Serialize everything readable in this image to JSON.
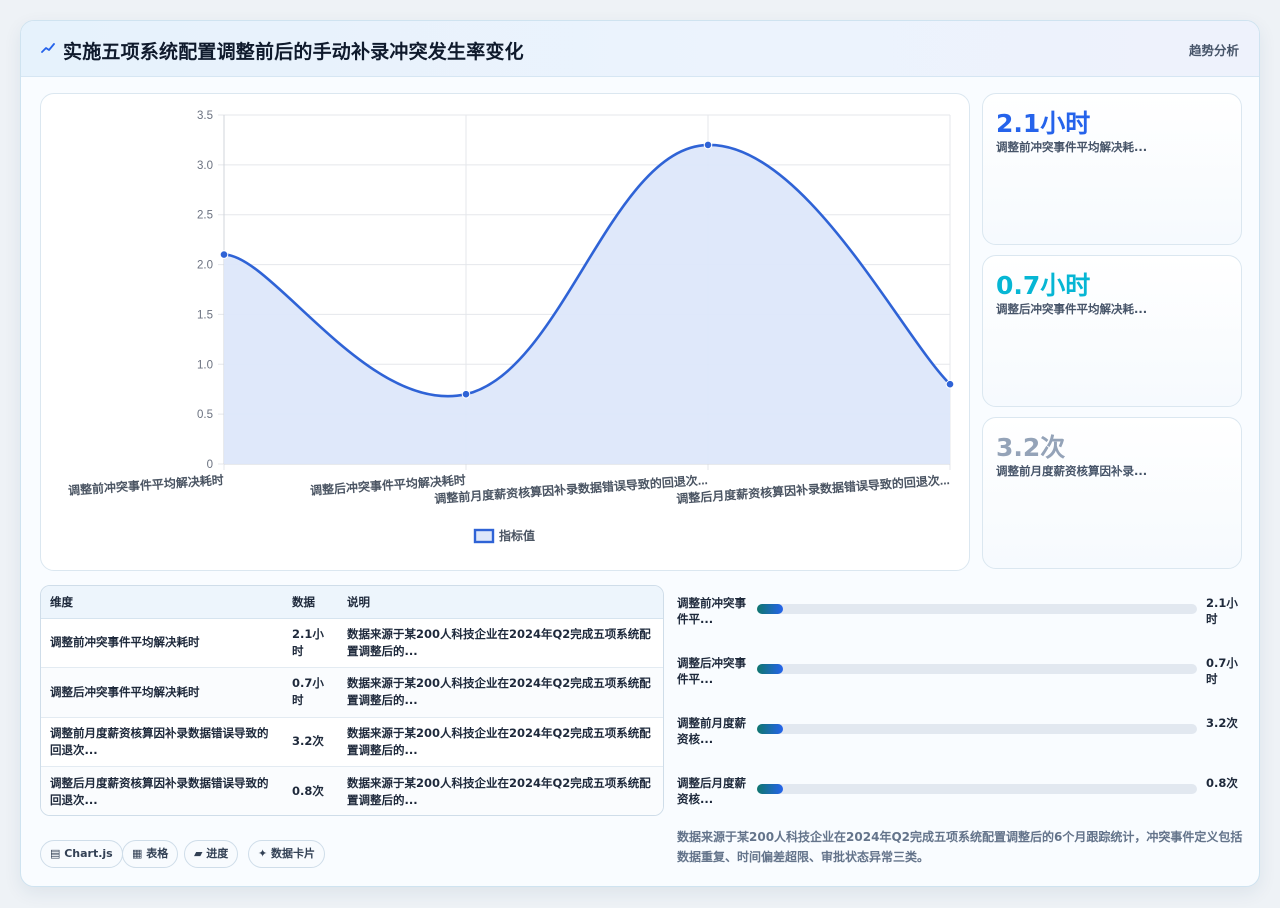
{
  "header": {
    "title": "实施五项系统配置调整前后的手动补录冲突发生率变化",
    "tag": "趋势分析"
  },
  "chart_data": {
    "type": "line",
    "categories": [
      "调整前冲突事件平均解决耗时",
      "调整后冲突事件平均解决耗时",
      "调整前月度薪资核算因补录数据错误导致的回退次...",
      "调整后月度薪资核算因补录数据错误导致的回退次..."
    ],
    "series": [
      {
        "name": "指标值",
        "values": [
          2.1,
          0.7,
          3.2,
          0.8
        ]
      }
    ],
    "ylim": [
      0,
      3.5
    ],
    "yticks": [
      "0",
      "0.5",
      "1.0",
      "1.5",
      "2.0",
      "2.5",
      "3.0",
      "3.5"
    ],
    "grid": true,
    "legend": "bottom",
    "fill": true,
    "colors": {
      "line": "#2f63d6",
      "area": "#dde7fa"
    }
  },
  "kpis": [
    {
      "value": "2.1小时",
      "label": "调整前冲突事件平均解决耗...",
      "color": "#2563eb"
    },
    {
      "value": "0.7小时",
      "label": "调整后冲突事件平均解决耗...",
      "color": "#06b6d4"
    },
    {
      "value": "3.2次",
      "label": "调整前月度薪资核算因补录...",
      "color": "#94a3b8"
    }
  ],
  "table": {
    "headers": [
      "维度",
      "数据",
      "说明"
    ],
    "rows": [
      {
        "dim": "调整前冲突事件平均解决耗时",
        "data": "2.1小时",
        "desc": "数据来源于某200人科技企业在2024年Q2完成五项系统配置调整后的..."
      },
      {
        "dim": "调整后冲突事件平均解决耗时",
        "data": "0.7小时",
        "desc": "数据来源于某200人科技企业在2024年Q2完成五项系统配置调整后的..."
      },
      {
        "dim": "调整前月度薪资核算因补录数据错误导致的回退次...",
        "data": "3.2次",
        "desc": "数据来源于某200人科技企业在2024年Q2完成五项系统配置调整后的..."
      },
      {
        "dim": "调整后月度薪资核算因补录数据错误导致的回退次...",
        "data": "0.8次",
        "desc": "数据来源于某200人科技企业在2024年Q2完成五项系统配置调整后的..."
      }
    ]
  },
  "progress": [
    {
      "label": "调整前冲突事件平...",
      "value": "2.1小时",
      "fraction": 0.06
    },
    {
      "label": "调整后冲突事件平...",
      "value": "0.7小时",
      "fraction": 0.06
    },
    {
      "label": "调整前月度薪资核...",
      "value": "3.2次",
      "fraction": 0.06
    },
    {
      "label": "调整后月度薪资核...",
      "value": "0.8次",
      "fraction": 0.06
    }
  ],
  "note": "数据来源于某200人科技企业在2024年Q2完成五项系统配置调整后的6个月跟踪统计，冲突事件定义包括数据重复、时间偏差超限、审批状态异常三类。",
  "chips": [
    "▤ Chart.js",
    "▦ 表格",
    "▰ 进度",
    "✦ 数据卡片"
  ]
}
